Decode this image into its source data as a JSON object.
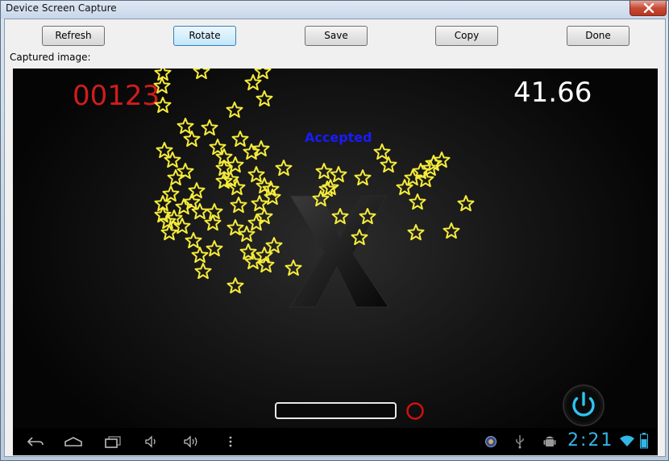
{
  "window": {
    "title": "Device Screen Capture"
  },
  "toolbar": {
    "refresh_label": "Refresh",
    "rotate_label": "Rotate",
    "save_label": "Save",
    "copy_label": "Copy",
    "done_label": "Done"
  },
  "capture": {
    "label": "Captured image:"
  },
  "game": {
    "score": "00123",
    "timer": "41.66",
    "status": "Accepted"
  },
  "system_bar": {
    "clock": "2:21",
    "icons": [
      "back-icon",
      "home-icon",
      "recent-apps-icon",
      "volume-down-icon",
      "volume-up-icon",
      "menu-icon",
      "app-notification-icon",
      "usb-icon",
      "android-debug-icon",
      "wifi-icon",
      "battery-icon"
    ]
  },
  "colors": {
    "score": "#d21c1c",
    "status": "#1a1aff",
    "clock": "#33b5e5",
    "star": "#f5ec3a"
  }
}
